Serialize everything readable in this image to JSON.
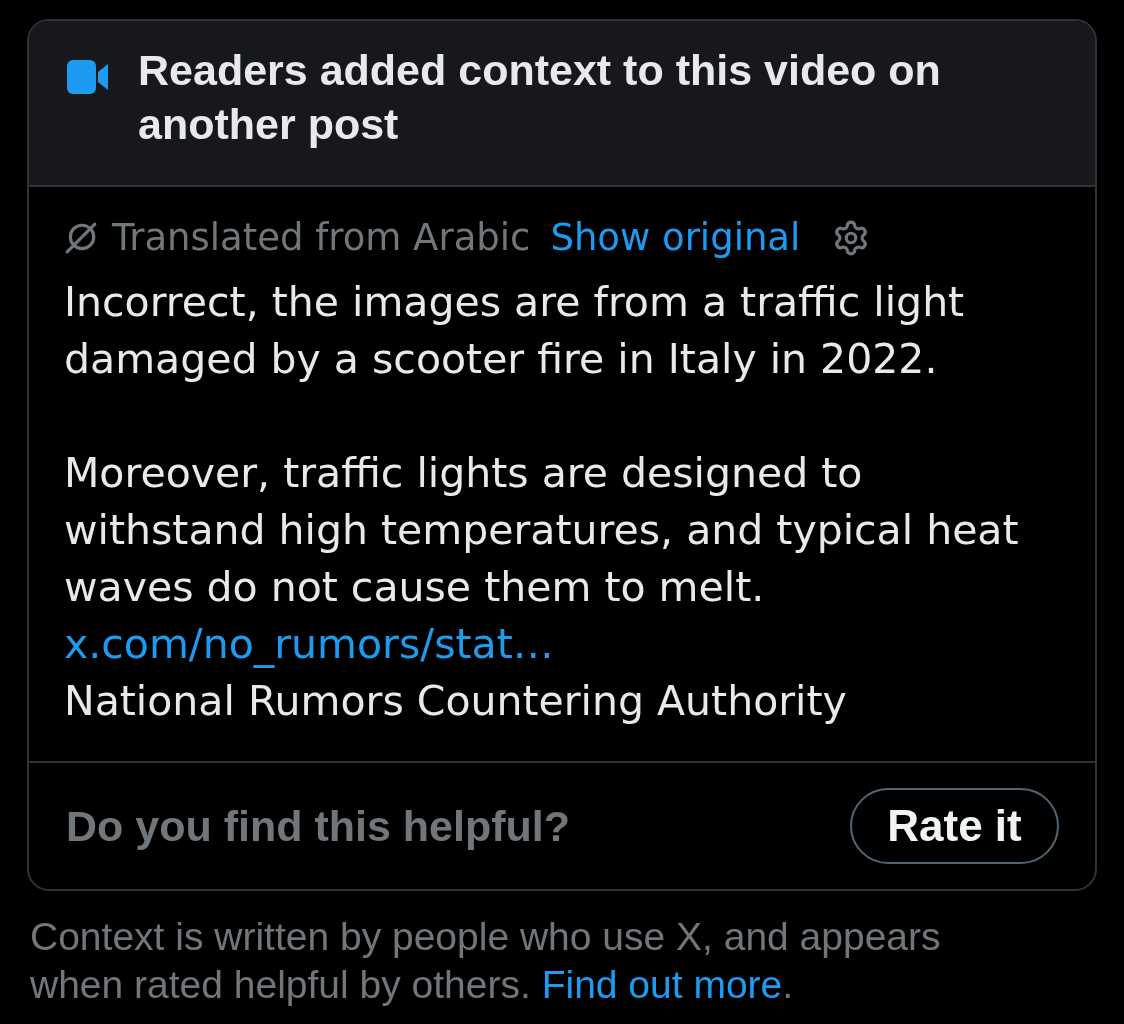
{
  "header": {
    "title": "Readers added context to this video on another post"
  },
  "translation": {
    "label": "Translated from Arabic",
    "link": "Show original"
  },
  "note": {
    "paragraphs": [
      "Incorrect, the images are from a traffic light damaged by a scooter fire in Italy in 2022.",
      "Moreover, traffic lights are designed to withstand high temperatures, and typical heat waves do not cause them to melt."
    ],
    "link": "x.com/no_rumors/stat…",
    "source": "National Rumors Countering Authority"
  },
  "footer": {
    "question": "Do you find this helpful?",
    "button": "Rate it"
  },
  "disclaimer": {
    "text": "Context is written by people who use X, and appears when rated helpful by others.",
    "link": "Find out more",
    "end": "."
  }
}
